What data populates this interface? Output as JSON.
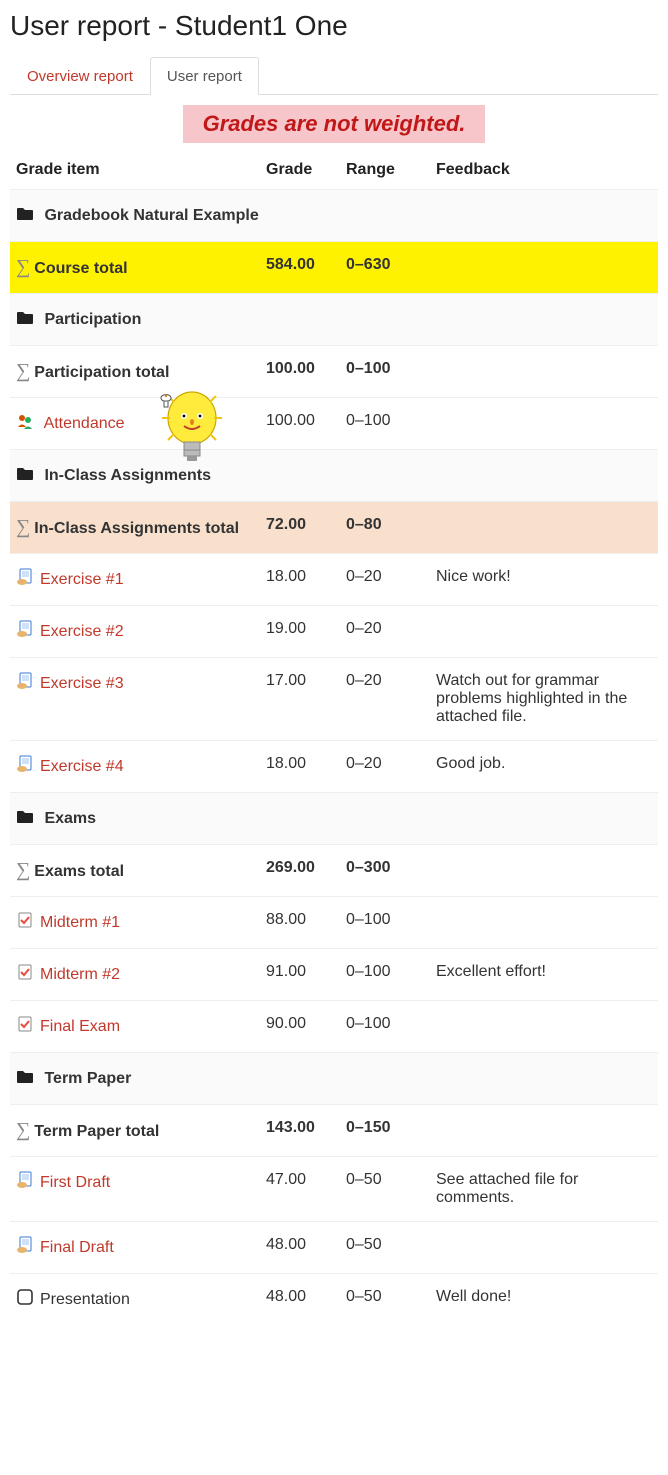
{
  "page_title": "User report - Student1 One",
  "tabs": {
    "overview": "Overview report",
    "user": "User report"
  },
  "banner": "Grades are not weighted.",
  "headers": {
    "item": "Grade item",
    "grade": "Grade",
    "range": "Range",
    "feedback": "Feedback"
  },
  "rows": {
    "course_name": "Gradebook Natural Example",
    "course_total": {
      "label": "Course total",
      "grade": "584.00",
      "range": "0–630"
    },
    "participation_cat": "Participation",
    "participation_total": {
      "label": "Participation total",
      "grade": "100.00",
      "range": "0–100"
    },
    "attendance": {
      "label": "Attendance",
      "grade": "100.00",
      "range": "0–100"
    },
    "inclass_cat": "In-Class Assignments",
    "inclass_total": {
      "label": "In-Class Assignments total",
      "grade": "72.00",
      "range": "0–80"
    },
    "ex1": {
      "label": "Exercise #1",
      "grade": "18.00",
      "range": "0–20",
      "feedback": "Nice work!"
    },
    "ex2": {
      "label": "Exercise #2",
      "grade": "19.00",
      "range": "0–20",
      "feedback": ""
    },
    "ex3": {
      "label": "Exercise #3",
      "grade": "17.00",
      "range": "0–20",
      "feedback": "Watch out for grammar problems highlighted in the attached file."
    },
    "ex4": {
      "label": "Exercise #4",
      "grade": "18.00",
      "range": "0–20",
      "feedback": "Good job."
    },
    "exams_cat": "Exams",
    "exams_total": {
      "label": "Exams total",
      "grade": "269.00",
      "range": "0–300"
    },
    "mid1": {
      "label": "Midterm #1",
      "grade": "88.00",
      "range": "0–100",
      "feedback": ""
    },
    "mid2": {
      "label": "Midterm #2",
      "grade": "91.00",
      "range": "0–100",
      "feedback": "Excellent effort!"
    },
    "final": {
      "label": "Final Exam",
      "grade": "90.00",
      "range": "0–100",
      "feedback": ""
    },
    "paper_cat": "Term Paper",
    "paper_total": {
      "label": "Term Paper total",
      "grade": "143.00",
      "range": "0–150"
    },
    "draft1": {
      "label": "First Draft",
      "grade": "47.00",
      "range": "0–50",
      "feedback": "See attached file for comments."
    },
    "draft2": {
      "label": "Final Draft",
      "grade": "48.00",
      "range": "0–50",
      "feedback": ""
    },
    "presentation": {
      "label": "Presentation",
      "grade": "48.00",
      "range": "0–50",
      "feedback": "Well done!"
    }
  }
}
